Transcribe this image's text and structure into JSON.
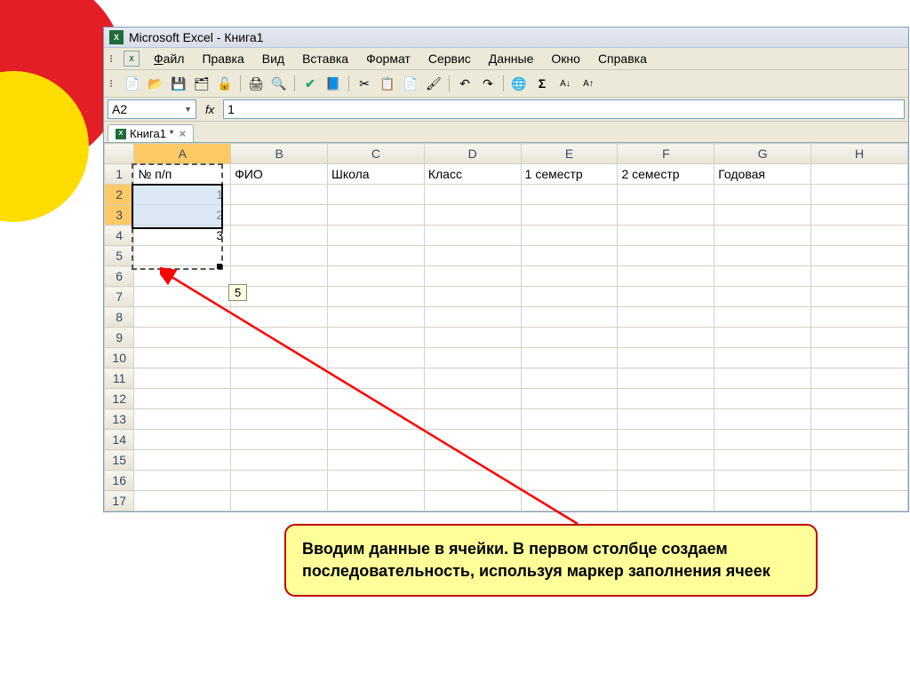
{
  "window": {
    "title": "Microsoft Excel - Книга1"
  },
  "menu": {
    "file": "Файл",
    "edit": "Правка",
    "view": "Вид",
    "insert": "Вставка",
    "format": "Формат",
    "tools": "Сервис",
    "data": "Данные",
    "window": "Окно",
    "help": "Справка"
  },
  "namebox": {
    "value": "A2"
  },
  "formula": {
    "value": "1"
  },
  "fx_label": "fx",
  "tab": {
    "label": "Книга1 *",
    "close": "×"
  },
  "columns": [
    "A",
    "B",
    "C",
    "D",
    "E",
    "F",
    "G",
    "H"
  ],
  "rows": [
    "1",
    "2",
    "3",
    "4",
    "5",
    "6",
    "7",
    "8",
    "9",
    "10",
    "11",
    "12",
    "13",
    "14",
    "15",
    "16",
    "17"
  ],
  "headers": {
    "c0": "№ п/п",
    "c1": "ФИО",
    "c2": "Школа",
    "c3": "Класс",
    "c4": "1 семестр",
    "c5": "2 семестр",
    "c6": "Годовая"
  },
  "dataA": {
    "r2": "1",
    "r3": "2",
    "r4": "3"
  },
  "tooltip": "5",
  "annotation": "Вводим данные в ячейки. В первом столбце создаем последовательность, используя маркер заполнения ячеек"
}
